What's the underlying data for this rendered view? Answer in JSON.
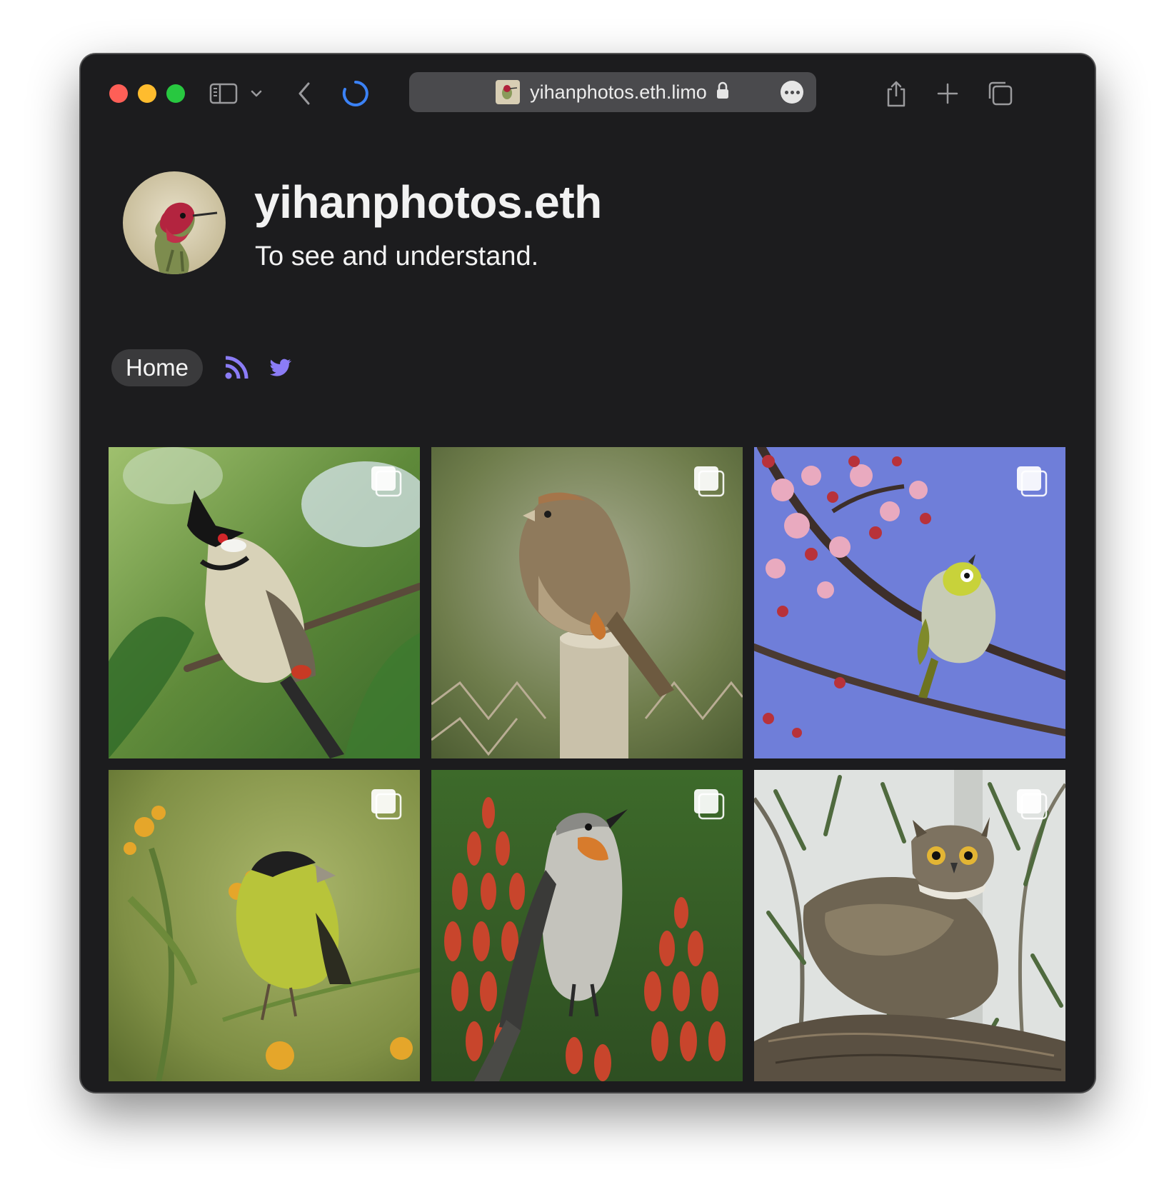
{
  "browser": {
    "url": "yihanphotos.eth.limo",
    "traffic_lights": [
      "#fe5f57",
      "#febc2e",
      "#28c840"
    ]
  },
  "site": {
    "title": "yihanphotos.eth",
    "tagline": "To see and understand."
  },
  "nav": {
    "home_label": "Home",
    "icons": [
      "rss-icon",
      "twitter-icon"
    ],
    "icon_color": "#8b7cf6"
  },
  "gallery": {
    "photos": [
      {
        "subject": "red-whiskered bulbul"
      },
      {
        "subject": "california towhee"
      },
      {
        "subject": "white-eye on blossoms"
      },
      {
        "subject": "lesser goldfinch"
      },
      {
        "subject": "mockingbird on aloe"
      },
      {
        "subject": "great horned owl"
      }
    ]
  }
}
